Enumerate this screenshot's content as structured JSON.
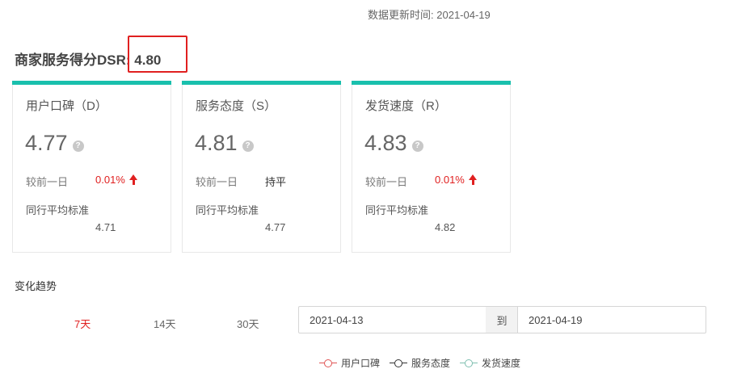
{
  "header": {
    "update_label": "数据更新时间:",
    "update_date": "2021-04-19"
  },
  "dsr": {
    "label": "商家服务得分DSR:",
    "score": "4.80",
    "highlight_color": "#e02020"
  },
  "accent_color": "#19c0ad",
  "cards": [
    {
      "name": "用户口碑（D）",
      "score": "4.77",
      "help_icon": "question-icon",
      "compare_label": "较前一日",
      "compare_value": "0.01%",
      "compare_trend": "up",
      "avg_label": "同行平均标准",
      "avg_value": "4.71"
    },
    {
      "name": "服务态度（S）",
      "score": "4.81",
      "help_icon": "question-icon",
      "compare_label": "较前一日",
      "compare_value": "持平",
      "compare_trend": "flat",
      "avg_label": "同行平均标准",
      "avg_value": "4.77"
    },
    {
      "name": "发货速度（R）",
      "score": "4.83",
      "help_icon": "question-icon",
      "compare_label": "较前一日",
      "compare_value": "0.01%",
      "compare_trend": "up",
      "avg_label": "同行平均标准",
      "avg_value": "4.82"
    }
  ],
  "trend": {
    "title": "变化趋势",
    "ranges": [
      {
        "label": "7天",
        "active": true
      },
      {
        "label": "14天",
        "active": false
      },
      {
        "label": "30天",
        "active": false
      }
    ],
    "start_date": "2021-04-13",
    "separator": "到",
    "end_date": "2021-04-19",
    "legend": [
      {
        "label": "用户口碑",
        "color": "#e05555"
      },
      {
        "label": "服务态度",
        "color": "#333333"
      },
      {
        "label": "发货速度",
        "color": "#7fbfb0"
      }
    ]
  }
}
